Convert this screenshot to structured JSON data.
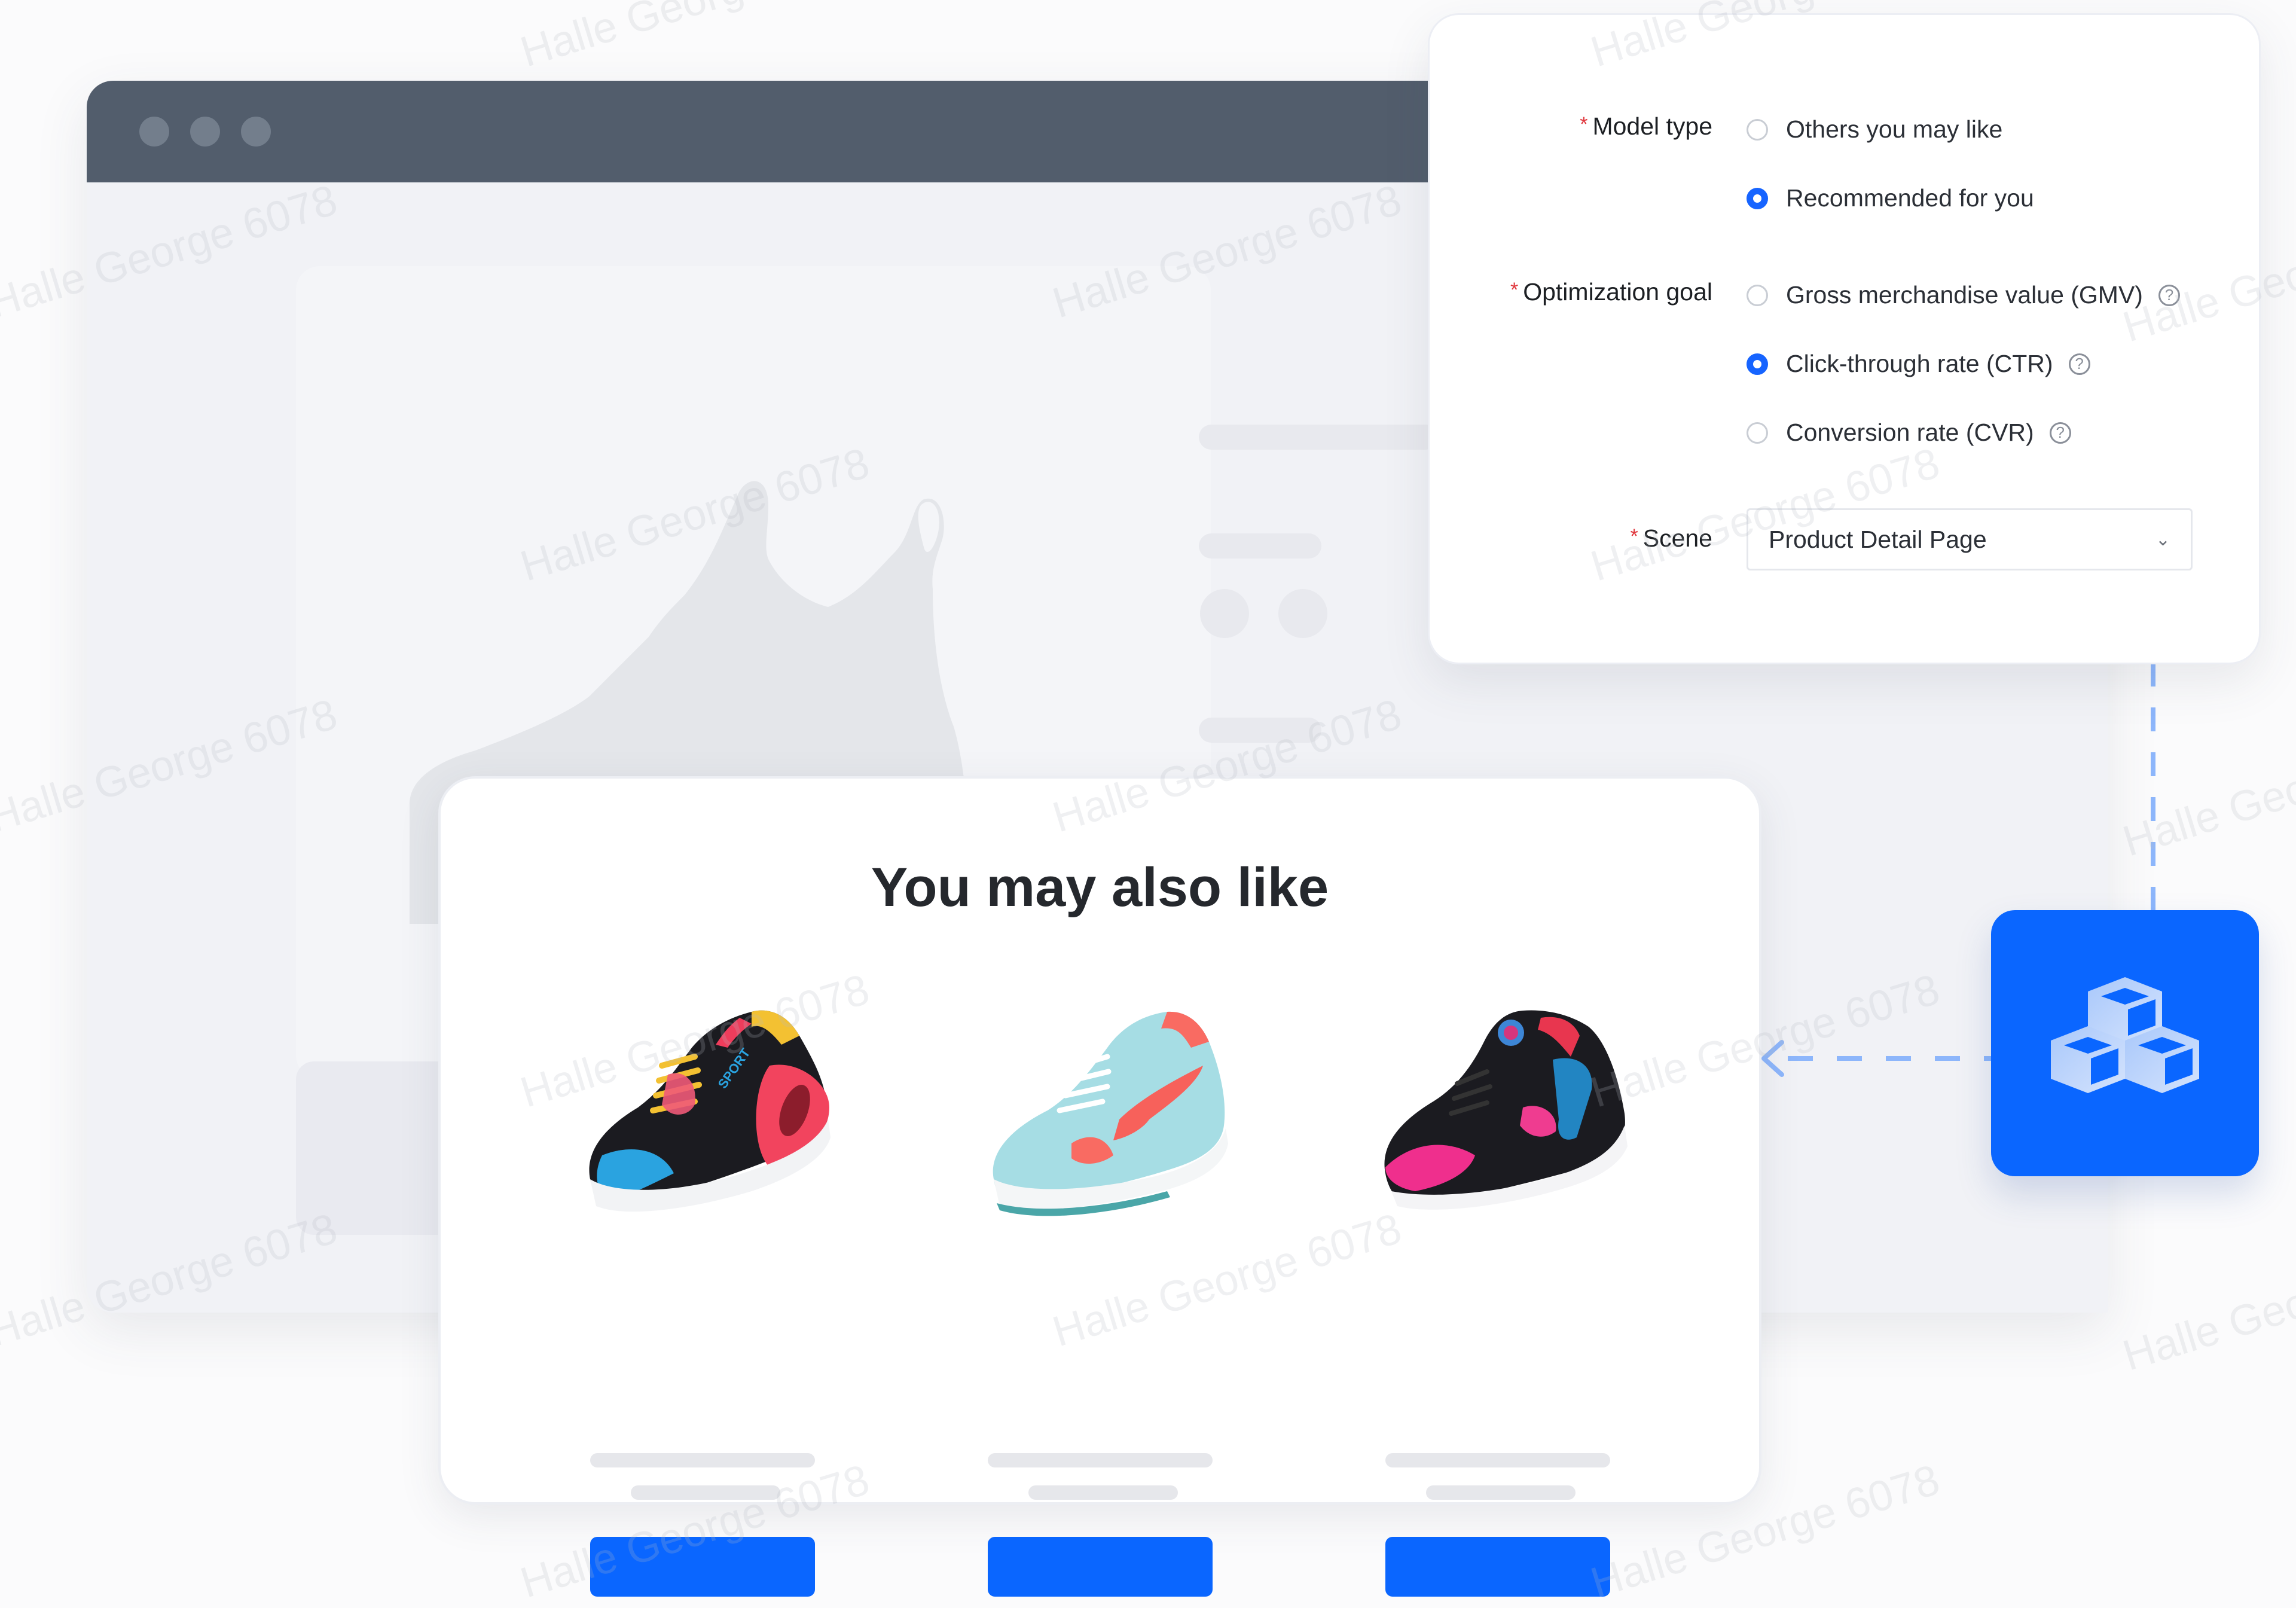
{
  "config_panel": {
    "model_type": {
      "label": "Model type",
      "required_mark": "*",
      "options": [
        {
          "label": "Others you may like",
          "selected": false
        },
        {
          "label": "Recommended for you",
          "selected": true
        }
      ]
    },
    "optimization_goal": {
      "label": "Optimization goal",
      "required_mark": "*",
      "options": [
        {
          "label": "Gross merchandise value (GMV)",
          "selected": false,
          "help_icon": "question-circle-icon"
        },
        {
          "label": "Click-through rate (CTR)",
          "selected": true,
          "help_icon": "question-circle-icon"
        },
        {
          "label": "Conversion rate (CVR)",
          "selected": false,
          "help_icon": "question-circle-icon"
        }
      ]
    },
    "scene": {
      "label": "Scene",
      "required_mark": "*",
      "selected_value": "Product Detail Page",
      "chevron": "⌄"
    },
    "help_glyph": "?"
  },
  "recommendations": {
    "title": "You may also like",
    "products": [
      {
        "name": "black-pink-yellow-sport-sneaker",
        "badge_text": "SPORT"
      },
      {
        "name": "light-blue-coral-sneaker"
      },
      {
        "name": "black-pink-blue-huarache-sneaker"
      }
    ]
  },
  "cube_box": {
    "icon": "cubes-icon"
  },
  "watermark": "Halle George 6078",
  "colors": {
    "accent": "#0a66ff",
    "radio_on": "#1664ff",
    "titlebar": "#525d6c",
    "required": "#e0383e",
    "dash": "#8db6fb"
  }
}
